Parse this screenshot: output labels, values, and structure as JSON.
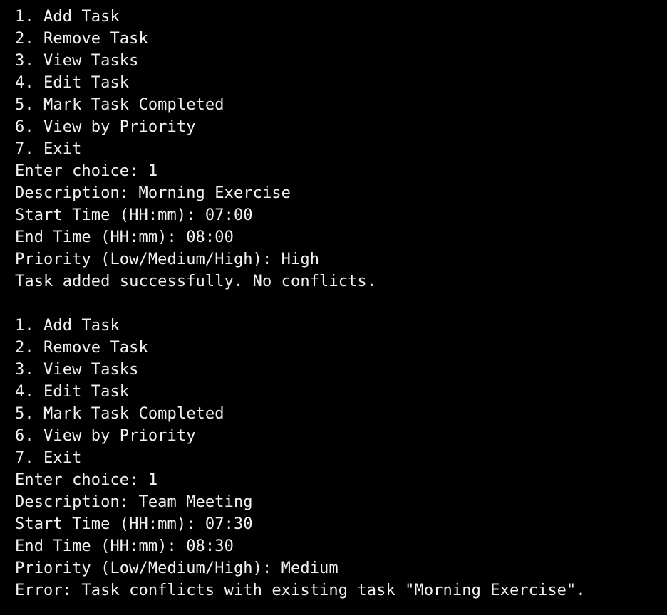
{
  "terminal": {
    "session1": {
      "menu": [
        "1. Add Task",
        "2. Remove Task",
        "3. View Tasks",
        "4. Edit Task",
        "5. Mark Task Completed",
        "6. View by Priority",
        "7. Exit"
      ],
      "prompt_choice": "Enter choice: 1",
      "description": "Description: Morning Exercise",
      "start_time": "Start Time (HH:mm): 07:00",
      "end_time": "End Time (HH:mm): 08:00",
      "priority": "Priority (Low/Medium/High): High",
      "result": "Task added successfully. No conflicts."
    },
    "session2": {
      "menu": [
        "1. Add Task",
        "2. Remove Task",
        "3. View Tasks",
        "4. Edit Task",
        "5. Mark Task Completed",
        "6. View by Priority",
        "7. Exit"
      ],
      "prompt_choice": "Enter choice: 1",
      "description": "Description: Team Meeting",
      "start_time": "Start Time (HH:mm): 07:30",
      "end_time": "End Time (HH:mm): 08:30",
      "priority": "Priority (Low/Medium/High): Medium",
      "result": "Error: Task conflicts with existing task \"Morning Exercise\"."
    },
    "colors": {
      "background": "#000000",
      "text": "#f2f2f2"
    }
  }
}
